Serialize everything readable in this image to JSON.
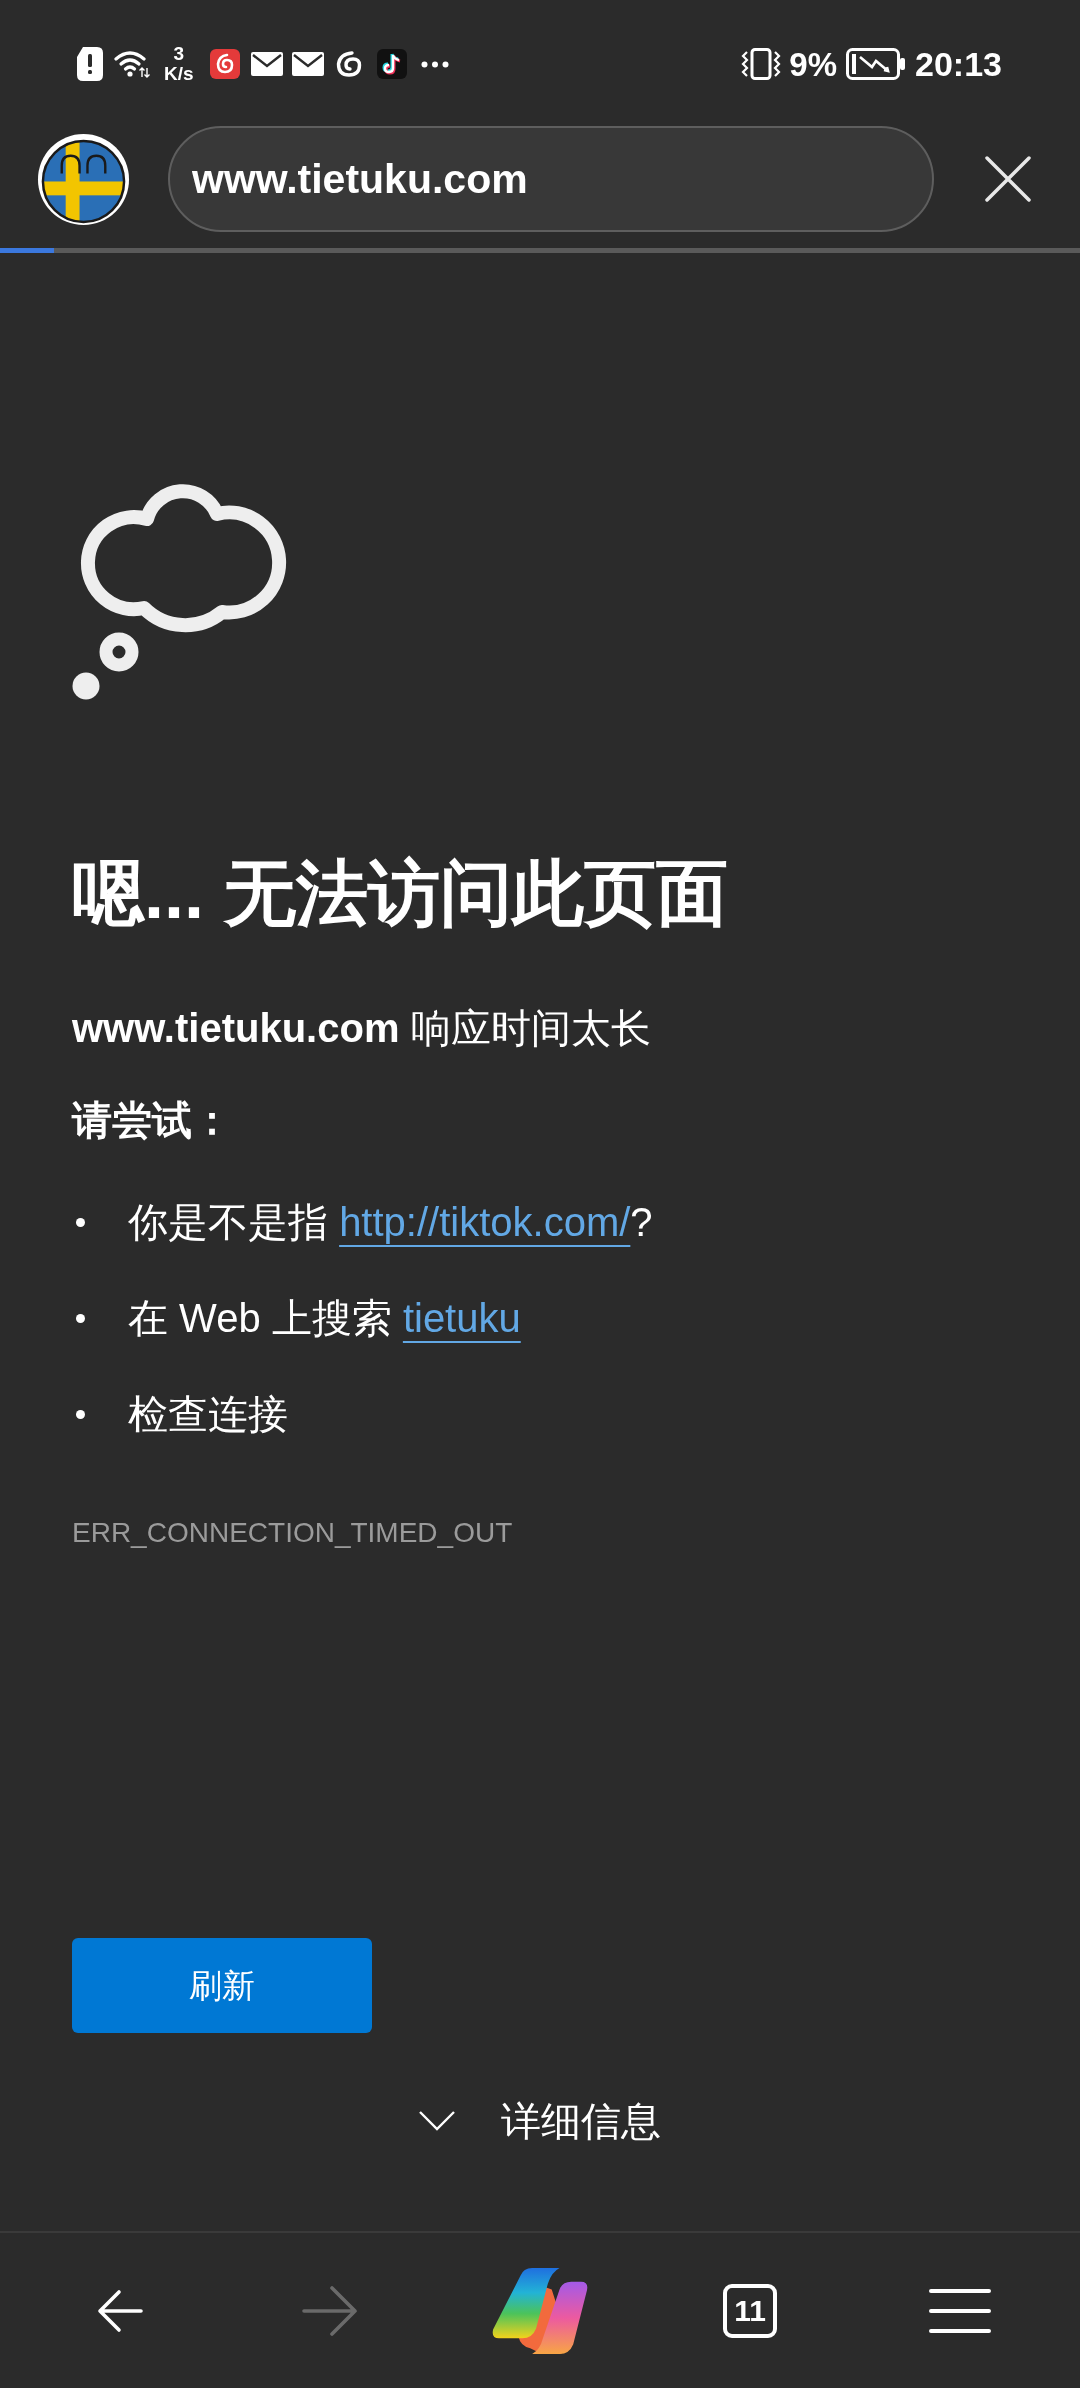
{
  "status_bar": {
    "speed_value": "3",
    "speed_unit": "K/s",
    "battery": "9%",
    "time": "20:13"
  },
  "toolbar": {
    "url": "www.tietuku.com"
  },
  "load_progress": {
    "level": 0.05
  },
  "error_page": {
    "heading": "嗯... 无法访问此页面",
    "message": "**www.tietuku.com** 响应时间太长",
    "suggestions_title": "请尝试：",
    "suggestions": [
      {
        "text": "你是不是指",
        "link": "http://tiktok.com/",
        "suffix": "?"
      },
      {
        "text": "在 Web 上搜索",
        "link": "tietuku"
      },
      {
        "text": "检查连接"
      }
    ],
    "error_code": "ERR_CONNECTION_TIMED_OUT",
    "refresh_button": "刷新",
    "details": {
      "label": "详细信息",
      "expanded": false
    }
  },
  "bottom_nav": [
    {
      "kind": "back",
      "disabled": false
    },
    {
      "kind": "forward",
      "disabled": true
    },
    {
      "kind": "assistant"
    },
    {
      "kind": "tabs",
      "count": "11"
    },
    {
      "kind": "menu"
    }
  ]
}
